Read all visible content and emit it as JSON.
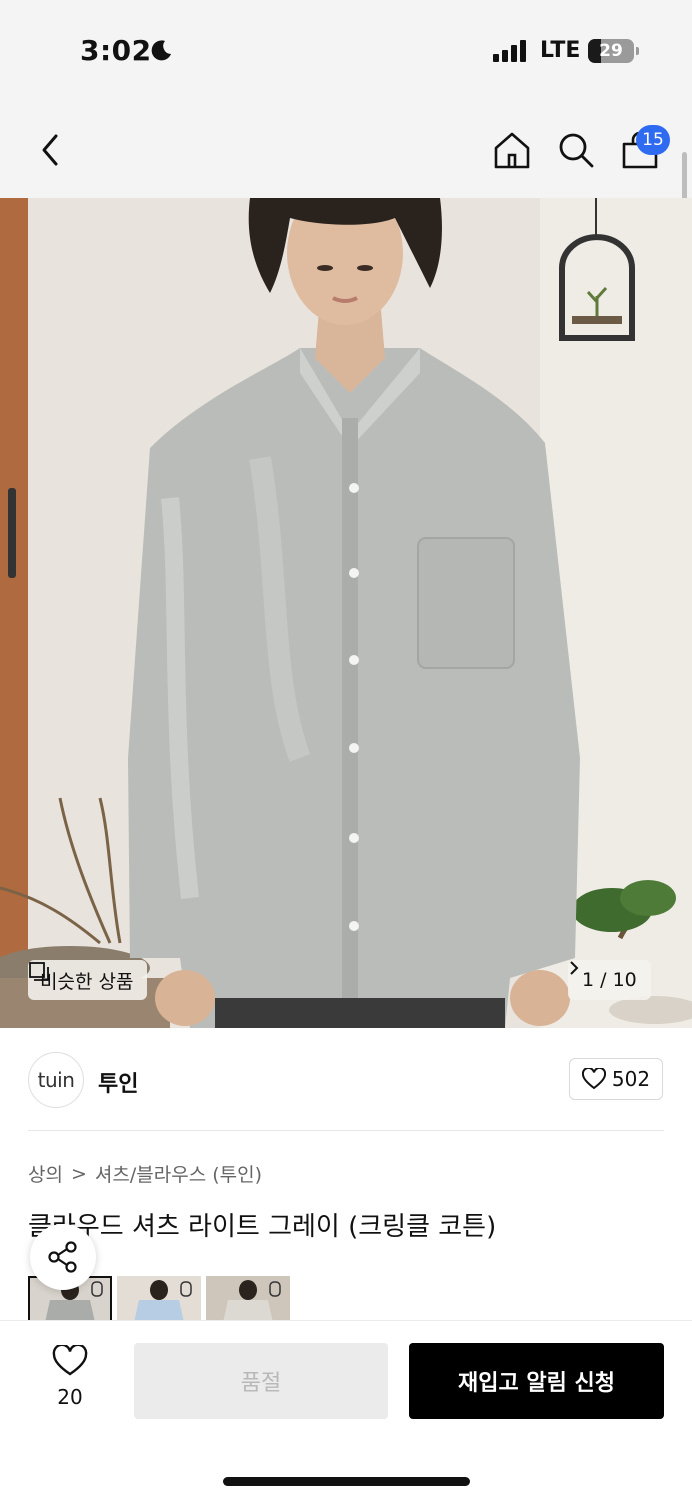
{
  "status_bar": {
    "time": "3:02",
    "network": "LTE",
    "battery": "29",
    "battery_level": 0.29
  },
  "nav": {
    "cart_count": "15"
  },
  "hero": {
    "similar_label": "비슷한 상품",
    "pager": "1 / 10"
  },
  "brand": {
    "logo_text": "tuin",
    "name": "투인",
    "likes": "502"
  },
  "breadcrumb": {
    "level1": "상의",
    "separator": ">",
    "level2": "셔츠/블라우스 (투인)"
  },
  "product": {
    "title": "클라우드 셔츠 라이트 그레이 (크링클 코튼)"
  },
  "colors": {
    "accent_badge": "#2f6bf0",
    "cta": "#000000",
    "disabled": "#ebebeb"
  },
  "bottom_bar": {
    "wish_count": "20",
    "soldout_label": "품절",
    "restock_label": "재입고 알림 신청"
  }
}
